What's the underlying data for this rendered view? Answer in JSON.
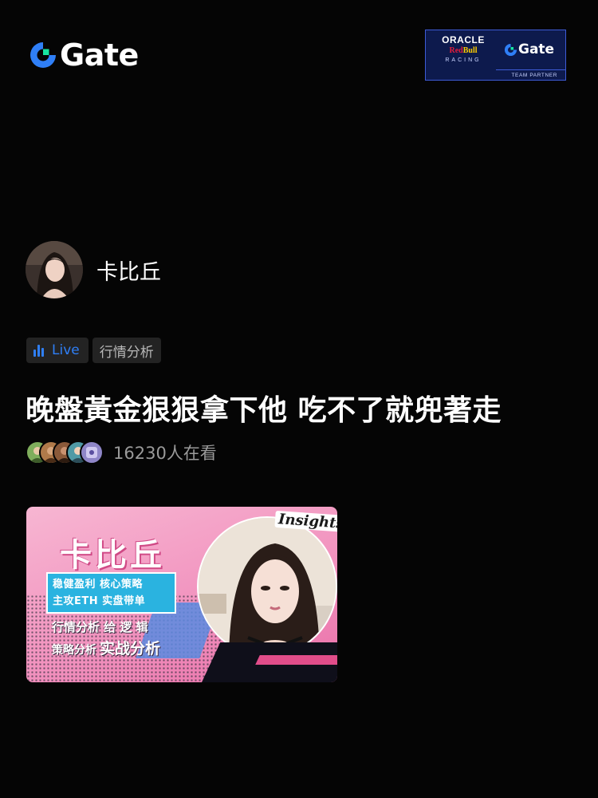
{
  "brand": {
    "name": "Gate",
    "logo_icon": "gate-logo-icon",
    "accent_color": "#2f7ff7",
    "green_accent": "#17e6a1"
  },
  "partner_badge": {
    "oracle": "ORACLE",
    "redbull_red": "Red",
    "redbull_bull": "Bull",
    "racing": "RACING",
    "gate": "Gate",
    "caption": "TEAM PARTNER",
    "bg_color": "#0d1a4d"
  },
  "host": {
    "name": "卡比丘",
    "avatar_icon": "host-avatar"
  },
  "tags": {
    "live_label": "Live",
    "live_icon": "bar-chart-icon",
    "category": "行情分析"
  },
  "stream": {
    "title": "晚盤黃金狠狠拿下他 吃不了就兜著走",
    "viewer_count": "16230",
    "viewer_suffix": "人在看"
  },
  "cover": {
    "name": "卡比丘",
    "box_line1": "稳健盈利  核心策略",
    "box_line2": "主攻ETH  实盘带单",
    "text1": "行情分析 给 逻 辑",
    "text2": "策略分析",
    "text2_emph": "实战分析",
    "badge": "Insights"
  }
}
